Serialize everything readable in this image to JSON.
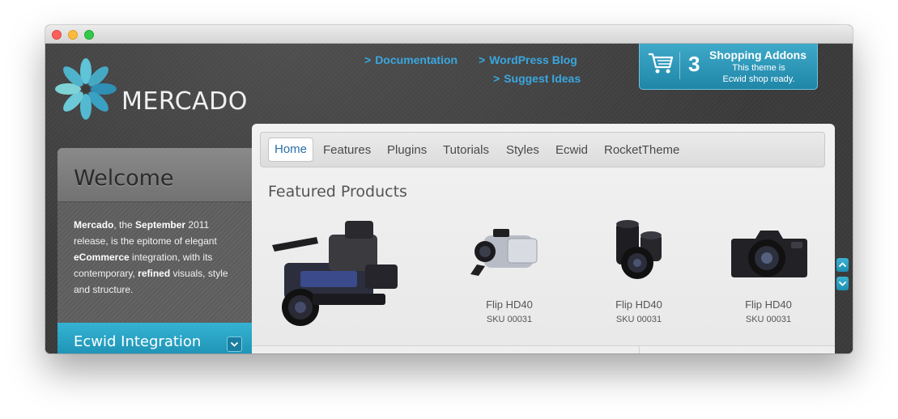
{
  "window": {
    "traffic_lights": [
      "close",
      "minimize",
      "zoom"
    ]
  },
  "logo": {
    "text": "MERCADO",
    "icon": "flower-logo-icon"
  },
  "header_links": {
    "documentation": "Documentation",
    "wordpress_blog": "WordPress Blog",
    "suggest_ideas": "Suggest Ideas",
    "chevron": ">"
  },
  "addons": {
    "number": "3",
    "title": "Shopping Addons",
    "line1": "This theme is",
    "line2": "Ecwid shop ready.",
    "icon": "cart-icon"
  },
  "sidebar": {
    "welcome_title": "Welcome",
    "welcome_body": [
      {
        "t": "Mercado",
        "b": true
      },
      {
        "t": ", the ",
        "b": false
      },
      {
        "t": "September",
        "b": true
      },
      {
        "t": " 2011 release, is the epitome of elegant ",
        "b": false
      },
      {
        "t": "eCommerce",
        "b": true
      },
      {
        "t": " integration, with its contemporary, ",
        "b": false
      },
      {
        "t": "refined",
        "b": true
      },
      {
        "t": " visuals, style and structure.",
        "b": false
      }
    ],
    "ecwid_title": "Ecwid Integration"
  },
  "nav": {
    "items": [
      "Home",
      "Features",
      "Plugins",
      "Tutorials",
      "Styles",
      "Ecwid",
      "RocketTheme"
    ],
    "active": "Home"
  },
  "main": {
    "featured_title": "Featured Products",
    "products": [
      {
        "name": "Flip HD40",
        "sku": "SKU 00031",
        "icon": "handheld-camcorder-icon"
      },
      {
        "name": "Flip HD40",
        "sku": "SKU 00031",
        "icon": "camera-lenses-icon"
      },
      {
        "name": "Flip HD40",
        "sku": "SKU 00031",
        "icon": "dslr-camera-icon"
      }
    ],
    "hero_icon": "pro-video-camera-icon"
  },
  "colors": {
    "accent_blue": "#3aa7e0",
    "addons_bg": "#1f86a8",
    "dark_bg": "#3b3b3b",
    "ecwid_bar": "#1c90b3"
  }
}
